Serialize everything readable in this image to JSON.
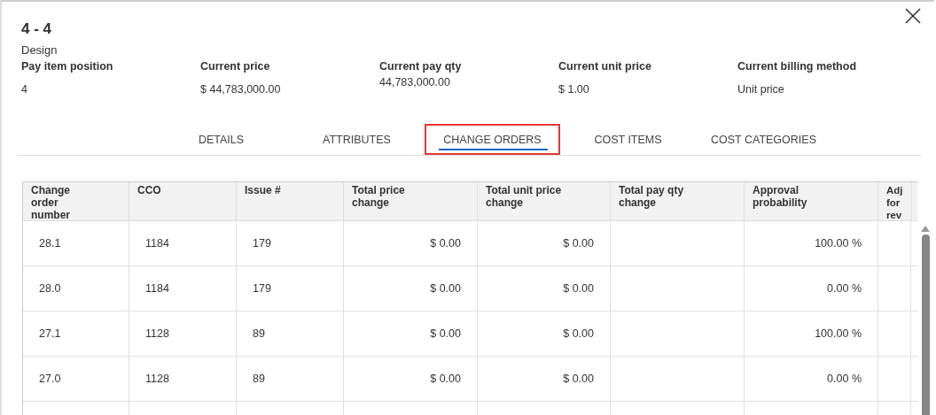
{
  "dialog": {
    "title": "4 - 4",
    "subtitle": "Design"
  },
  "summary": [
    {
      "label": "Pay item position",
      "value": "4"
    },
    {
      "label": "Current price",
      "value": "$ 44,783,000.00"
    },
    {
      "label": "Current pay qty",
      "value": "44,783,000.00"
    },
    {
      "label": "Current unit price",
      "value": "$ 1.00"
    },
    {
      "label": "Current billing method",
      "value": "Unit price"
    }
  ],
  "tabs": [
    {
      "label": "DETAILS",
      "selected": false
    },
    {
      "label": "ATTRIBUTES",
      "selected": false
    },
    {
      "label": "CHANGE ORDERS",
      "selected": true
    },
    {
      "label": "COST ITEMS",
      "selected": false
    },
    {
      "label": "COST CATEGORIES",
      "selected": false
    }
  ],
  "table": {
    "columns": [
      {
        "label": "Change order number"
      },
      {
        "label": "CCO"
      },
      {
        "label": "Issue #"
      },
      {
        "label": "Total price change"
      },
      {
        "label": "Total unit price change"
      },
      {
        "label": "Total pay qty change"
      },
      {
        "label": "Approval probability"
      },
      {
        "label": "Adj for rev"
      }
    ],
    "rows": [
      [
        "28.1",
        "1184",
        "179",
        "$ 0.00",
        "$ 0.00",
        "",
        "100.00 %",
        ""
      ],
      [
        "28.0",
        "1184",
        "179",
        "$ 0.00",
        "$ 0.00",
        "",
        "0.00 %",
        ""
      ],
      [
        "27.1",
        "1128",
        "89",
        "$ 0.00",
        "$ 0.00",
        "",
        "100.00 %",
        ""
      ],
      [
        "27.0",
        "1128",
        "89",
        "$ 0.00",
        "$ 0.00",
        "",
        "0.00 %",
        ""
      ]
    ]
  }
}
